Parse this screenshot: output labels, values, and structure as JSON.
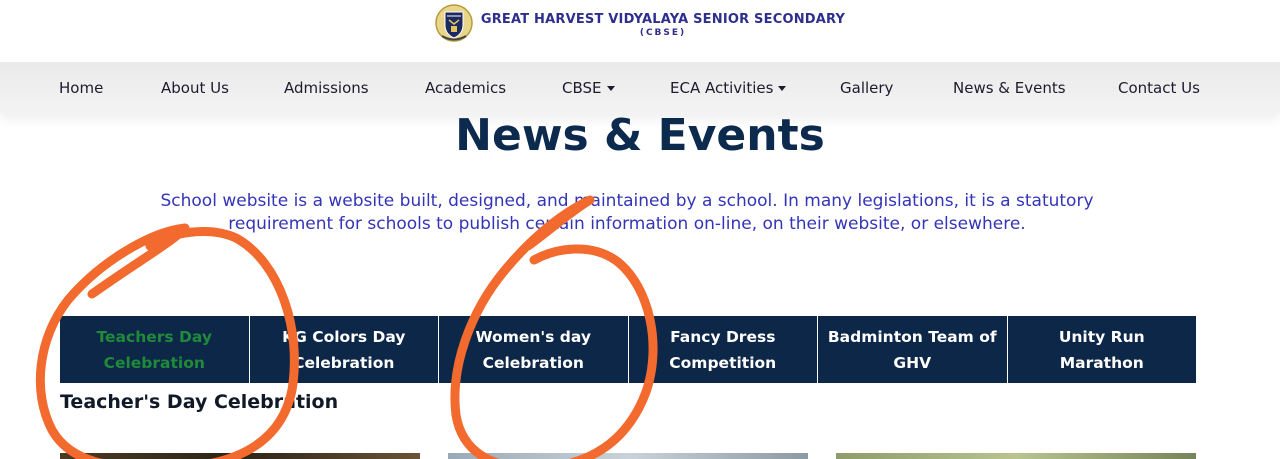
{
  "brand": {
    "title": "GREAT HARVEST VIDYALAYA SENIOR SECONDARY",
    "subtitle": "(CBSE)"
  },
  "nav": {
    "items": [
      {
        "label": "Home"
      },
      {
        "label": "About Us"
      },
      {
        "label": "Admissions"
      },
      {
        "label": "Academics"
      },
      {
        "label": "CBSE",
        "dropdown": true
      },
      {
        "label": "ECA Activities",
        "dropdown": true
      },
      {
        "label": "Gallery"
      },
      {
        "label": "News & Events"
      },
      {
        "label": "Contact Us"
      }
    ]
  },
  "page": {
    "heading": "News & Events",
    "intro": "School website is a website built, designed, and maintained by a school. In many legislations, it is a statutory requirement for schools to publish certain information on-line, on their website, or elsewhere."
  },
  "tabs": [
    {
      "label": "Teachers Day Celebration",
      "active": true
    },
    {
      "label": "KG Colors Day Celebration"
    },
    {
      "label": "Women's day Celebration"
    },
    {
      "label": "Fancy Dress Competition"
    },
    {
      "label": "Badminton Team of GHV"
    },
    {
      "label": "Unity Run Marathon"
    }
  ],
  "section": {
    "title": "Teacher's Day Celebration"
  },
  "colors": {
    "nav_bg": "#eeeeee",
    "tab_bg": "#0d2748",
    "tab_active_text": "#1f8a3a",
    "heading": "#0c2a4d",
    "intro_text": "#3434b8",
    "annotation": "#f26a2e"
  }
}
